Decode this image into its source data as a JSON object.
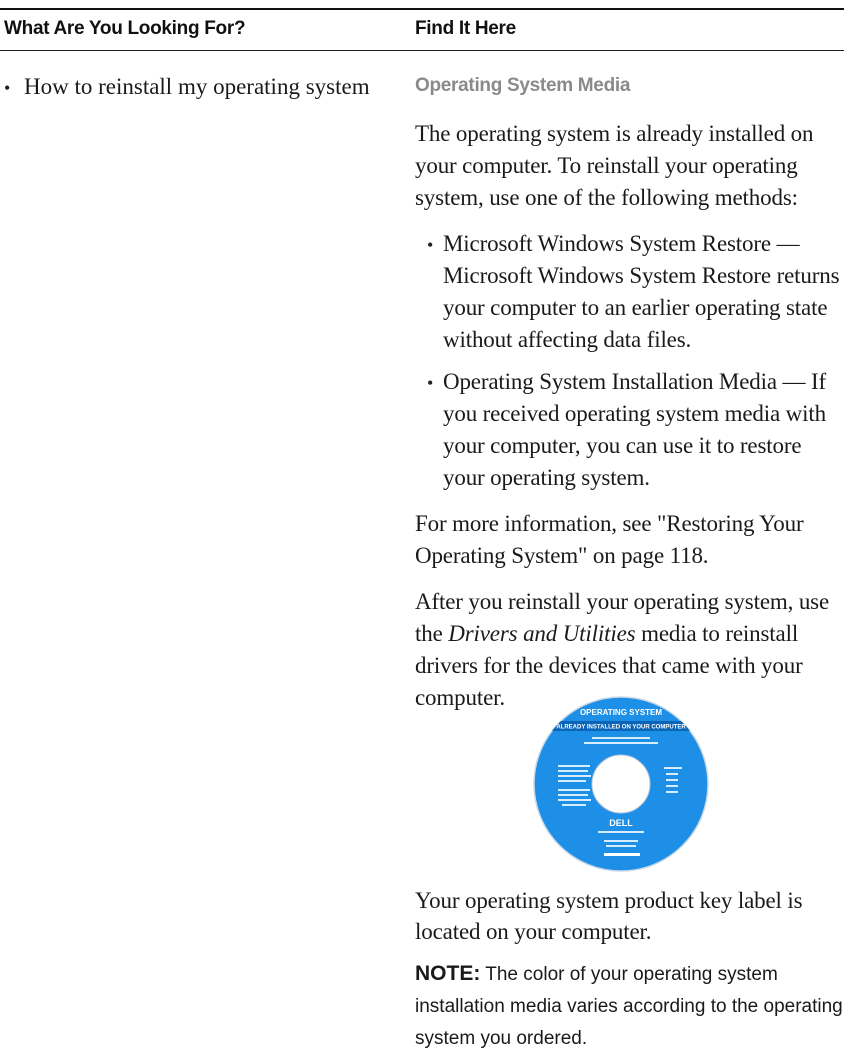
{
  "table": {
    "header_left": "What Are You Looking For?",
    "header_right": "Find It Here"
  },
  "left": {
    "bullet": "•",
    "item": "How to reinstall my operating system"
  },
  "right": {
    "section_title": "Operating System Media",
    "intro": "The operating system is already installed on your computer. To reinstall your operating system, use one of the following methods:",
    "methods": [
      {
        "bullet": "•",
        "text": "Microsoft Windows System Restore — Microsoft Windows System Restore returns your computer to an earlier operating state without affecting data files."
      },
      {
        "bullet": "•",
        "text": "Operating System Installation Media — If you received operating system media with your computer, you can use it to restore your operating system."
      }
    ],
    "more_info": "For more information, see \"Restoring Your Operating System\" on page 118.",
    "after_pre": "After you reinstall your operating system, use the ",
    "after_italic": "Drivers and Utilities",
    "after_post": " media to reinstall drivers for the devices that came with your computer.",
    "product_key": "Your operating system product key label is located on your computer.",
    "note_label": "NOTE:",
    "note_text": " The color of your operating system installation media varies according to the operating system you ordered."
  },
  "disc": {
    "title": "OPERATING SYSTEM",
    "band": "ALREADY INSTALLED ON YOUR COMPUTER",
    "brand": "DELL",
    "color": "#1e8fe6",
    "band_color": "#0a64b8"
  }
}
